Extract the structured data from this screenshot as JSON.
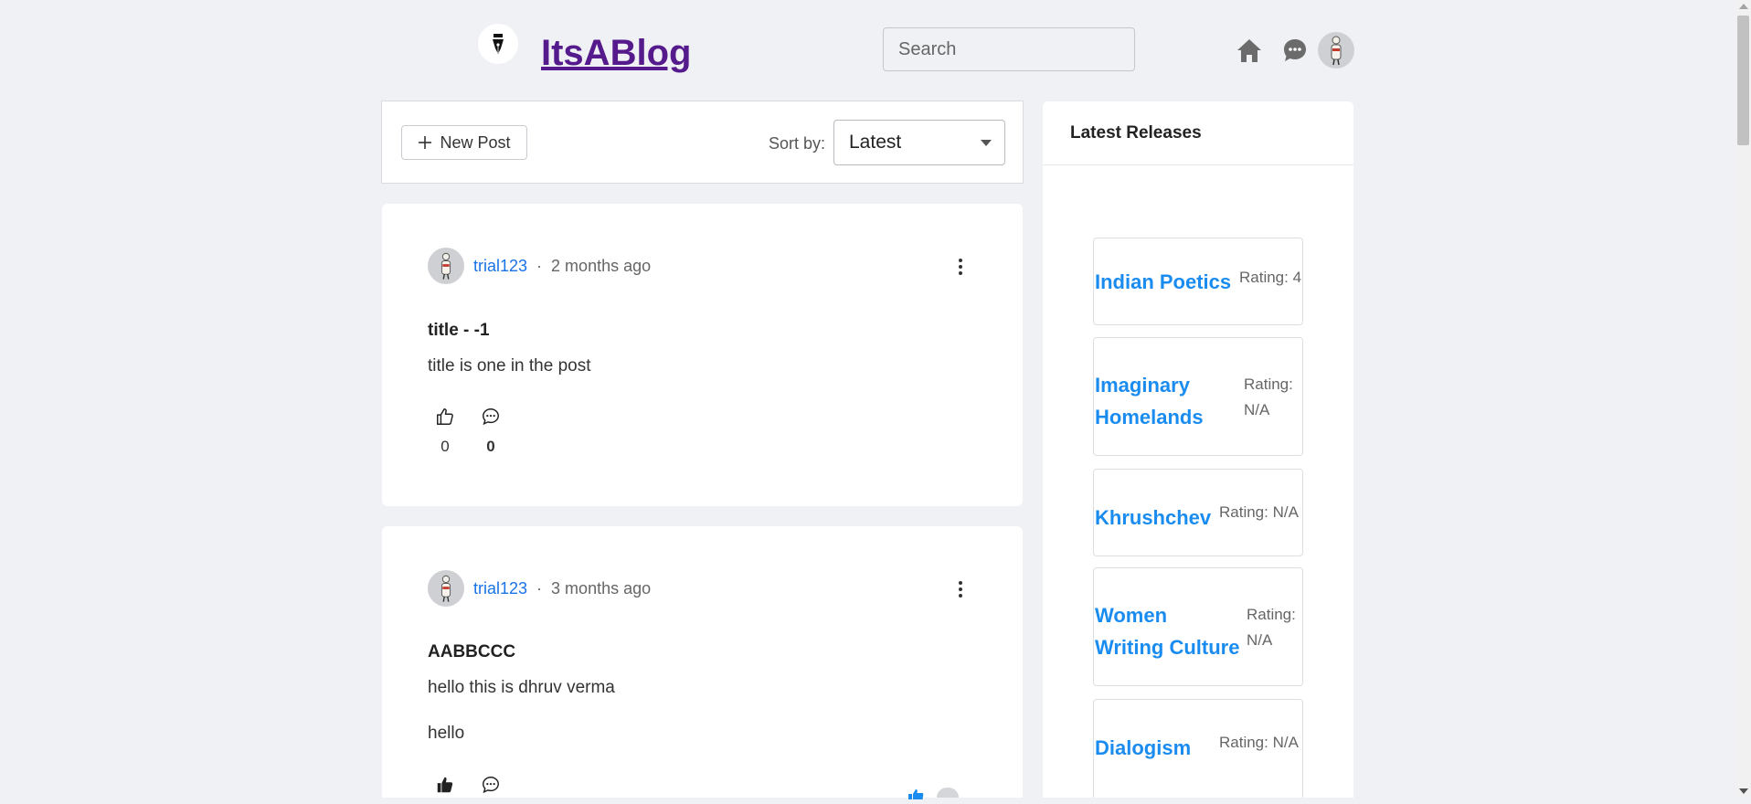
{
  "header": {
    "brand": "ItsABlog",
    "search_placeholder": "Search"
  },
  "toolbar": {
    "new_post_label": "New Post",
    "sort_label": "Sort by:",
    "sort_value": "Latest"
  },
  "posts": [
    {
      "author": "trial123",
      "separator": "·",
      "time": "2 months ago",
      "title": "title - -1",
      "body": [
        "title is one in the post"
      ],
      "likes": "0",
      "comments": "0"
    },
    {
      "author": "trial123",
      "separator": "·",
      "time": "3 months ago",
      "title": "AABBCCC",
      "body": [
        "hello this is dhruv verma",
        "hello"
      ]
    }
  ],
  "sidebar": {
    "heading": "Latest Releases",
    "releases": [
      {
        "name_lines": [
          "Indian Poetics"
        ],
        "rating_lines": [
          "Rating: 4"
        ]
      },
      {
        "name_lines": [
          "Imaginary",
          "Homelands"
        ],
        "rating_lines": [
          "Rating:",
          "N/A"
        ]
      },
      {
        "name_lines": [
          "Khrushchev"
        ],
        "rating_lines": [
          "Rating: N/A"
        ]
      },
      {
        "name_lines": [
          "Women",
          "Writing Culture"
        ],
        "rating_lines": [
          "Rating:",
          "N/A"
        ]
      },
      {
        "name_lines": [
          "Dialogism"
        ],
        "rating_lines": [
          "Rating: N/A"
        ]
      }
    ]
  },
  "icons": {
    "logo": "fountain-pen-nib-icon",
    "home": "home-icon",
    "chat": "chat-bubble-icon",
    "like": "thumbs-up-icon",
    "comment": "comment-bubble-icon",
    "more": "kebab-menu-icon"
  },
  "colors": {
    "brand": "#551a8b",
    "author_link": "#1a73e8",
    "release_link": "#1a8cf0",
    "background": "#f0f1f5"
  }
}
